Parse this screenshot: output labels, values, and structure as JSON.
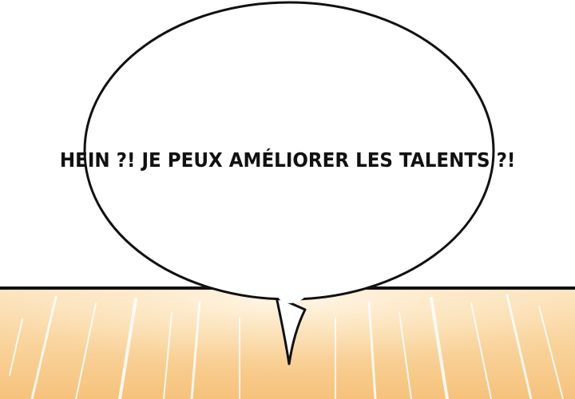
{
  "panel": {
    "speech_bubble": {
      "text": "HEIN ?! JE PEUX AMÉLIORER LES TALENTS ?!"
    },
    "colors": {
      "background_top": "#ffffff",
      "burst_light": "#fff4df",
      "burst_warm": "#f7c98a",
      "outline": "#111111"
    }
  }
}
